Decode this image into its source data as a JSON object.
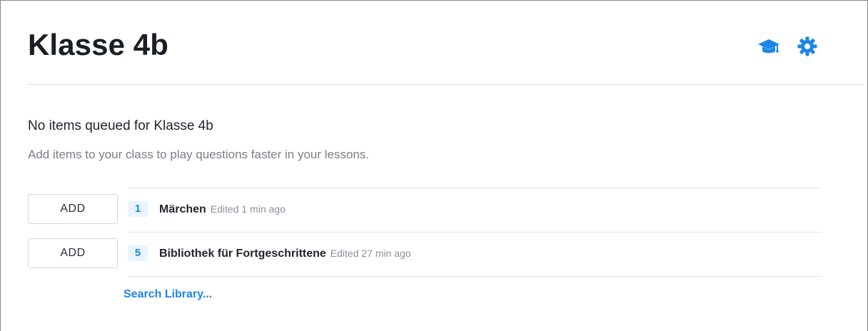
{
  "header": {
    "title": "Klasse 4b",
    "icons": [
      {
        "name": "graduation-cap-icon",
        "color": "#1c86e8"
      },
      {
        "name": "gear-icon",
        "color": "#1c86e8"
      }
    ]
  },
  "empty_state": {
    "title": "No items queued for Klasse 4b",
    "subtitle": "Add items to your class to play questions faster in your lessons."
  },
  "items": [
    {
      "add_label": "ADD",
      "count": "1",
      "title": "Märchen",
      "meta": "Edited 1 min ago"
    },
    {
      "add_label": "ADD",
      "count": "5",
      "title": "Bibliothek für Fortgeschrittene",
      "meta": "Edited 27 min ago"
    }
  ],
  "search_link": "Search Library...",
  "colors": {
    "accent": "#1c86e8",
    "badge_bg": "#eaf4fe"
  }
}
